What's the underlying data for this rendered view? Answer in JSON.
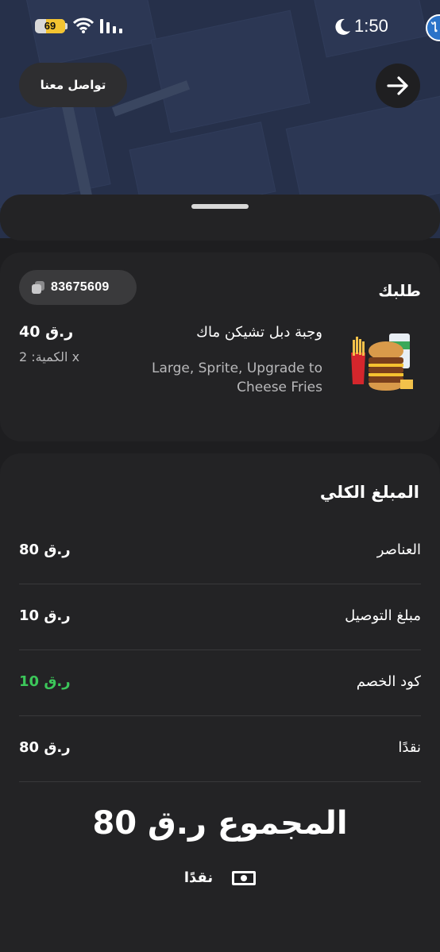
{
  "status_bar": {
    "battery_level": "69",
    "time": "1:50",
    "edge_badge_letter": "ไ"
  },
  "header": {
    "contact_label": "تواصل معنا",
    "back_icon": "arrow-right-icon"
  },
  "order": {
    "title": "طلبك",
    "order_id": "83675609",
    "copy_icon": "copy-icon",
    "item": {
      "name": "وجبة دبل تشيكن ماك",
      "options": "Large, Sprite, Upgrade to Cheese Fries",
      "price": "40 ر.ق",
      "quantity": "الكمية: 2 x",
      "image": "burger-meal-image"
    }
  },
  "summary": {
    "title": "المبلغ الكلي",
    "rows": [
      {
        "label": "العناصر",
        "value": "80 ر.ق",
        "type": "normal"
      },
      {
        "label": "مبلغ التوصيل",
        "value": "10 ر.ق",
        "type": "normal"
      },
      {
        "label": "كود الخصم",
        "value": "10 ر.ق",
        "type": "discount"
      },
      {
        "label": "نقدًا",
        "value": "80 ر.ق",
        "type": "normal"
      }
    ],
    "grand_total_label": "المجموع",
    "grand_total_value": "80 ر.ق",
    "payment_method": "نقدًا",
    "payment_icon": "cash-icon"
  },
  "colors": {
    "background": "#1e1e20",
    "card": "#232325",
    "discount_green": "#3cc75a",
    "map": "#26304a"
  }
}
